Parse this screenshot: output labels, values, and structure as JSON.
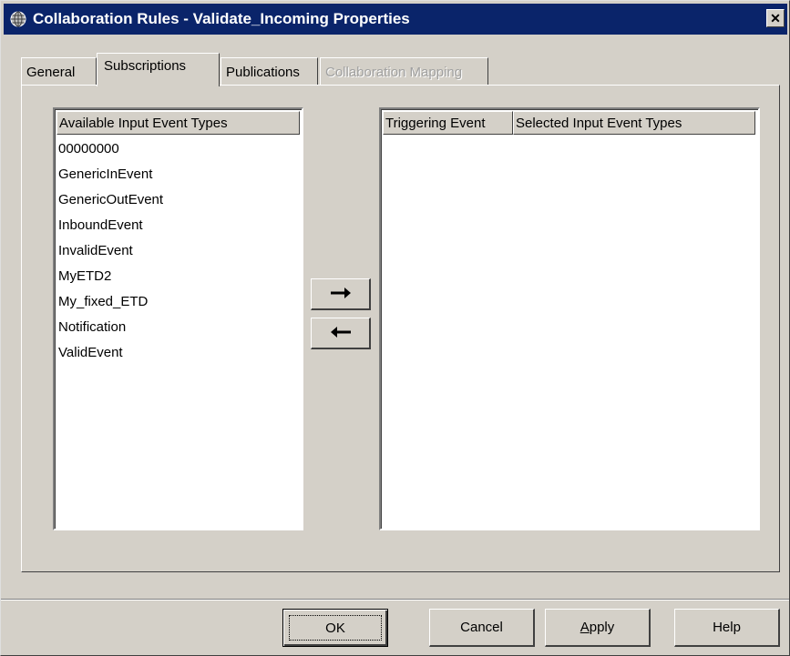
{
  "window": {
    "title": "Collaboration Rules - Validate_Incoming Properties",
    "close_glyph": "✕"
  },
  "tabs": [
    {
      "label": "General",
      "state": "normal"
    },
    {
      "label": "Subscriptions",
      "state": "active"
    },
    {
      "label": "Publications",
      "state": "normal"
    },
    {
      "label": "Collaboration Mapping",
      "state": "disabled"
    }
  ],
  "available_list": {
    "header": "Available Input Event Types",
    "items": [
      "00000000",
      "GenericInEvent",
      "GenericOutEvent",
      "InboundEvent",
      "InvalidEvent",
      "MyETD2",
      "My_fixed_ETD",
      "Notification",
      "ValidEvent"
    ]
  },
  "selected_list": {
    "header_triggering": "Triggering Event",
    "header_selected": "Selected Input Event Types",
    "items": []
  },
  "arrows": {
    "add_icon": "arrow-right-icon",
    "remove_icon": "arrow-left-icon"
  },
  "buttons": {
    "ok": "OK",
    "cancel": "Cancel",
    "apply_accel": "A",
    "apply_rest": "pply",
    "help": "Help"
  },
  "colors": {
    "titlebar": "#0a246a",
    "face": "#d4d0c8",
    "disabled_text": "#a0a0a0"
  }
}
